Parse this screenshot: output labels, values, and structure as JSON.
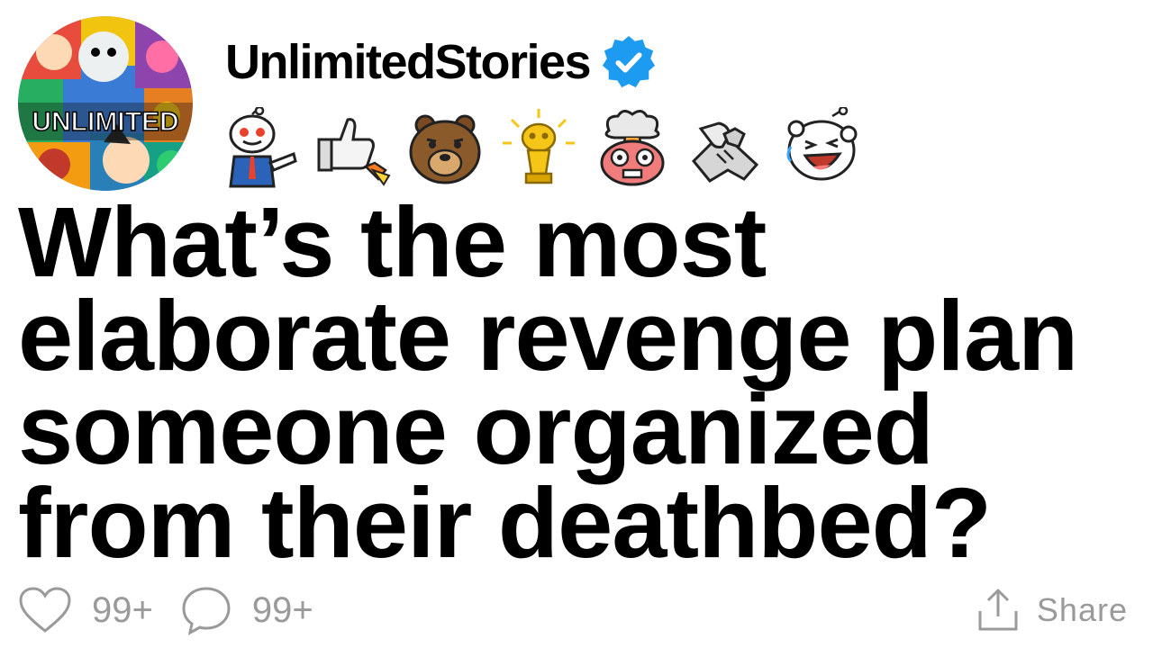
{
  "post": {
    "username": "UnlimitedStories",
    "avatar_label": "UNLIMITED",
    "verified": true,
    "title": "What’s the most elaborate revenge plan someone organized from their deathbed?"
  },
  "awards": [
    {
      "name": "pointing-snoo-award-icon"
    },
    {
      "name": "rocket-like-award-icon"
    },
    {
      "name": "bear-award-icon"
    },
    {
      "name": "gold-trophy-snoo-award-icon"
    },
    {
      "name": "mind-blown-award-icon"
    },
    {
      "name": "handshake-award-icon"
    },
    {
      "name": "laughing-snoo-award-icon"
    }
  ],
  "footer": {
    "likes": "99+",
    "comments": "99+",
    "share_label": "Share"
  },
  "colors": {
    "verified_blue": "#1d9bf0",
    "muted_gray": "#9a9a9a",
    "text": "#000000"
  }
}
